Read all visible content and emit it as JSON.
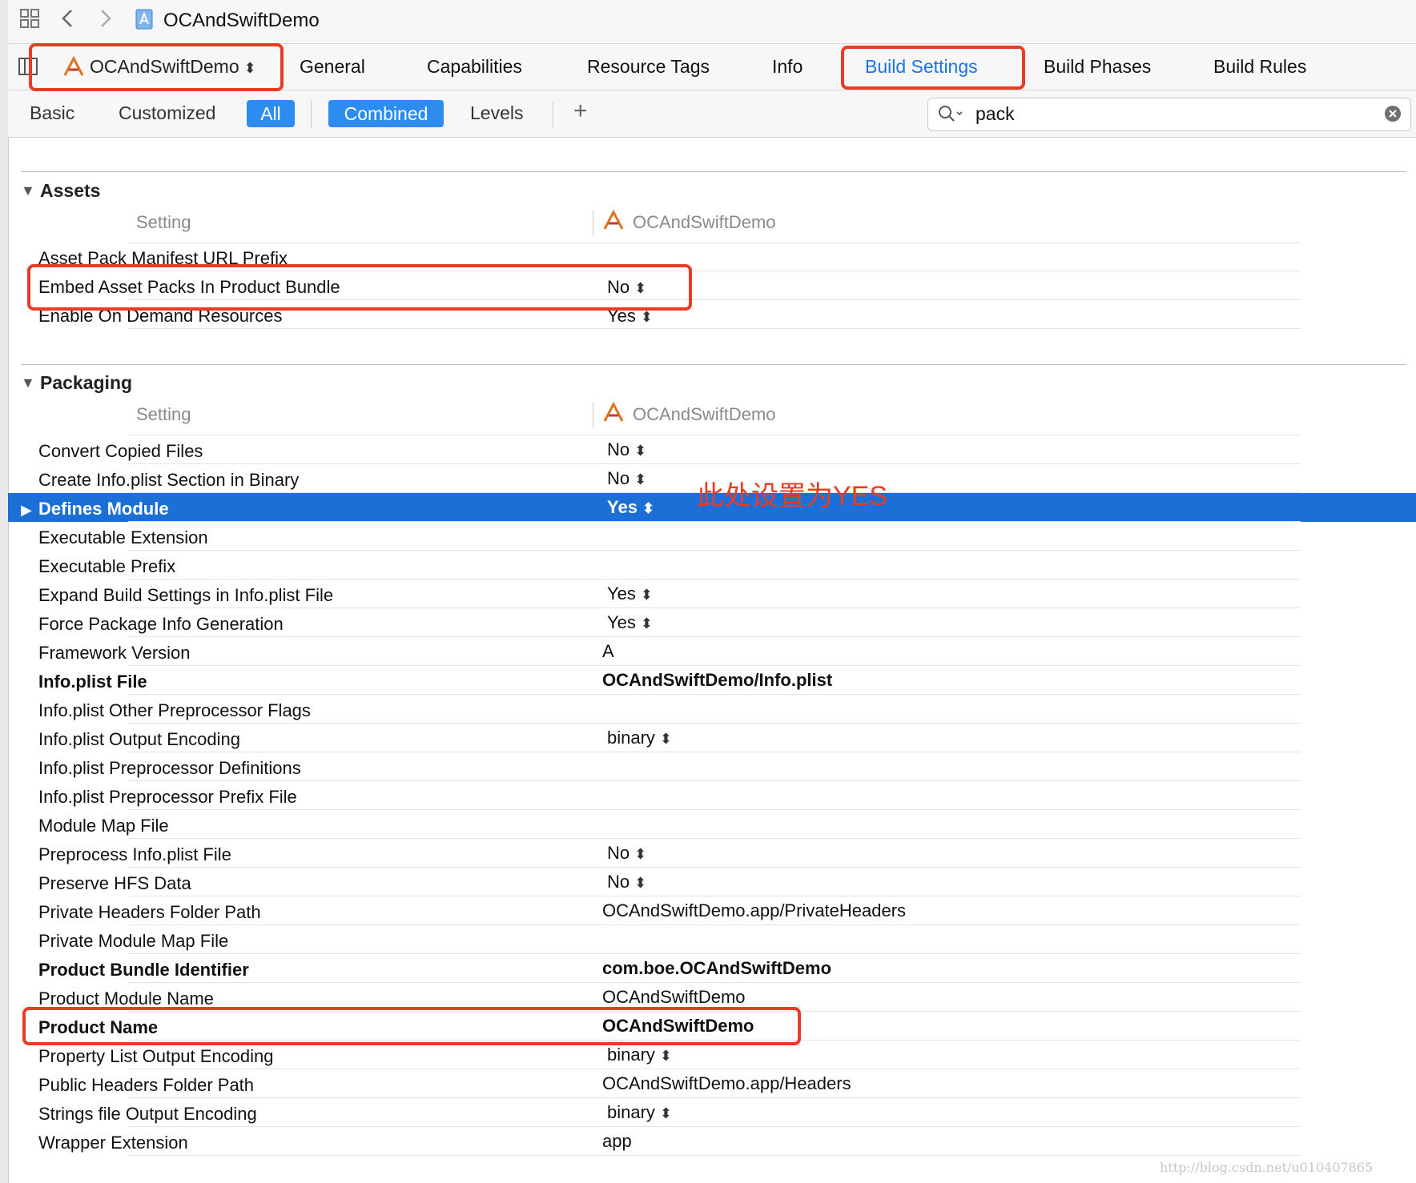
{
  "window": {
    "project_title": "OCAndSwiftDemo"
  },
  "tabs": {
    "target": "OCAndSwiftDemo",
    "items": [
      "General",
      "Capabilities",
      "Resource Tags",
      "Info",
      "Build Settings",
      "Build Phases",
      "Build Rules"
    ],
    "active": "Build Settings"
  },
  "filters": {
    "basic": "Basic",
    "customized": "Customized",
    "all": "All",
    "combined": "Combined",
    "levels": "Levels",
    "add": "+",
    "search_value": "pack"
  },
  "assets": {
    "title": "Assets",
    "col_setting": "Setting",
    "col_target": "OCAndSwiftDemo",
    "rows": [
      {
        "name": "Asset Pack Manifest URL Prefix",
        "value": ""
      },
      {
        "name": "Embed Asset Packs In Product Bundle",
        "value": "No"
      },
      {
        "name": "Enable On Demand Resources",
        "value": "Yes"
      }
    ]
  },
  "packaging": {
    "title": "Packaging",
    "col_setting": "Setting",
    "col_target": "OCAndSwiftDemo",
    "rows": [
      {
        "name": "Convert Copied Files",
        "value": "No"
      },
      {
        "name": "Create Info.plist Section in Binary",
        "value": "No"
      },
      {
        "name": "Defines Module",
        "value": "Yes"
      },
      {
        "name": "Executable Extension",
        "value": ""
      },
      {
        "name": "Executable Prefix",
        "value": ""
      },
      {
        "name": "Expand Build Settings in Info.plist File",
        "value": "Yes"
      },
      {
        "name": "Force Package Info Generation",
        "value": "Yes"
      },
      {
        "name": "Framework Version",
        "value": "A"
      },
      {
        "name": "Info.plist File",
        "value": "OCAndSwiftDemo/Info.plist"
      },
      {
        "name": "Info.plist Other Preprocessor Flags",
        "value": ""
      },
      {
        "name": "Info.plist Output Encoding",
        "value": "binary"
      },
      {
        "name": "Info.plist Preprocessor Definitions",
        "value": ""
      },
      {
        "name": "Info.plist Preprocessor Prefix File",
        "value": ""
      },
      {
        "name": "Module Map File",
        "value": ""
      },
      {
        "name": "Preprocess Info.plist File",
        "value": "No"
      },
      {
        "name": "Preserve HFS Data",
        "value": "No"
      },
      {
        "name": "Private Headers Folder Path",
        "value": "OCAndSwiftDemo.app/PrivateHeaders"
      },
      {
        "name": "Private Module Map File",
        "value": ""
      },
      {
        "name": "Product Bundle Identifier",
        "value": "com.boe.OCAndSwiftDemo"
      },
      {
        "name": "Product Module Name",
        "value": "OCAndSwiftDemo"
      },
      {
        "name": "Product Name",
        "value": "OCAndSwiftDemo"
      },
      {
        "name": "Property List Output Encoding",
        "value": "binary"
      },
      {
        "name": "Public Headers Folder Path",
        "value": "OCAndSwiftDemo.app/Headers"
      },
      {
        "name": "Strings file Output Encoding",
        "value": "binary"
      },
      {
        "name": "Wrapper Extension",
        "value": "app"
      }
    ]
  },
  "annotation_text": "此处设置为YES",
  "watermark": "http://blog.csdn.net/u010407865",
  "colors": {
    "accent": "#1a73e8",
    "selection": "#1b6fd6",
    "highlight": "#ea3b25"
  }
}
